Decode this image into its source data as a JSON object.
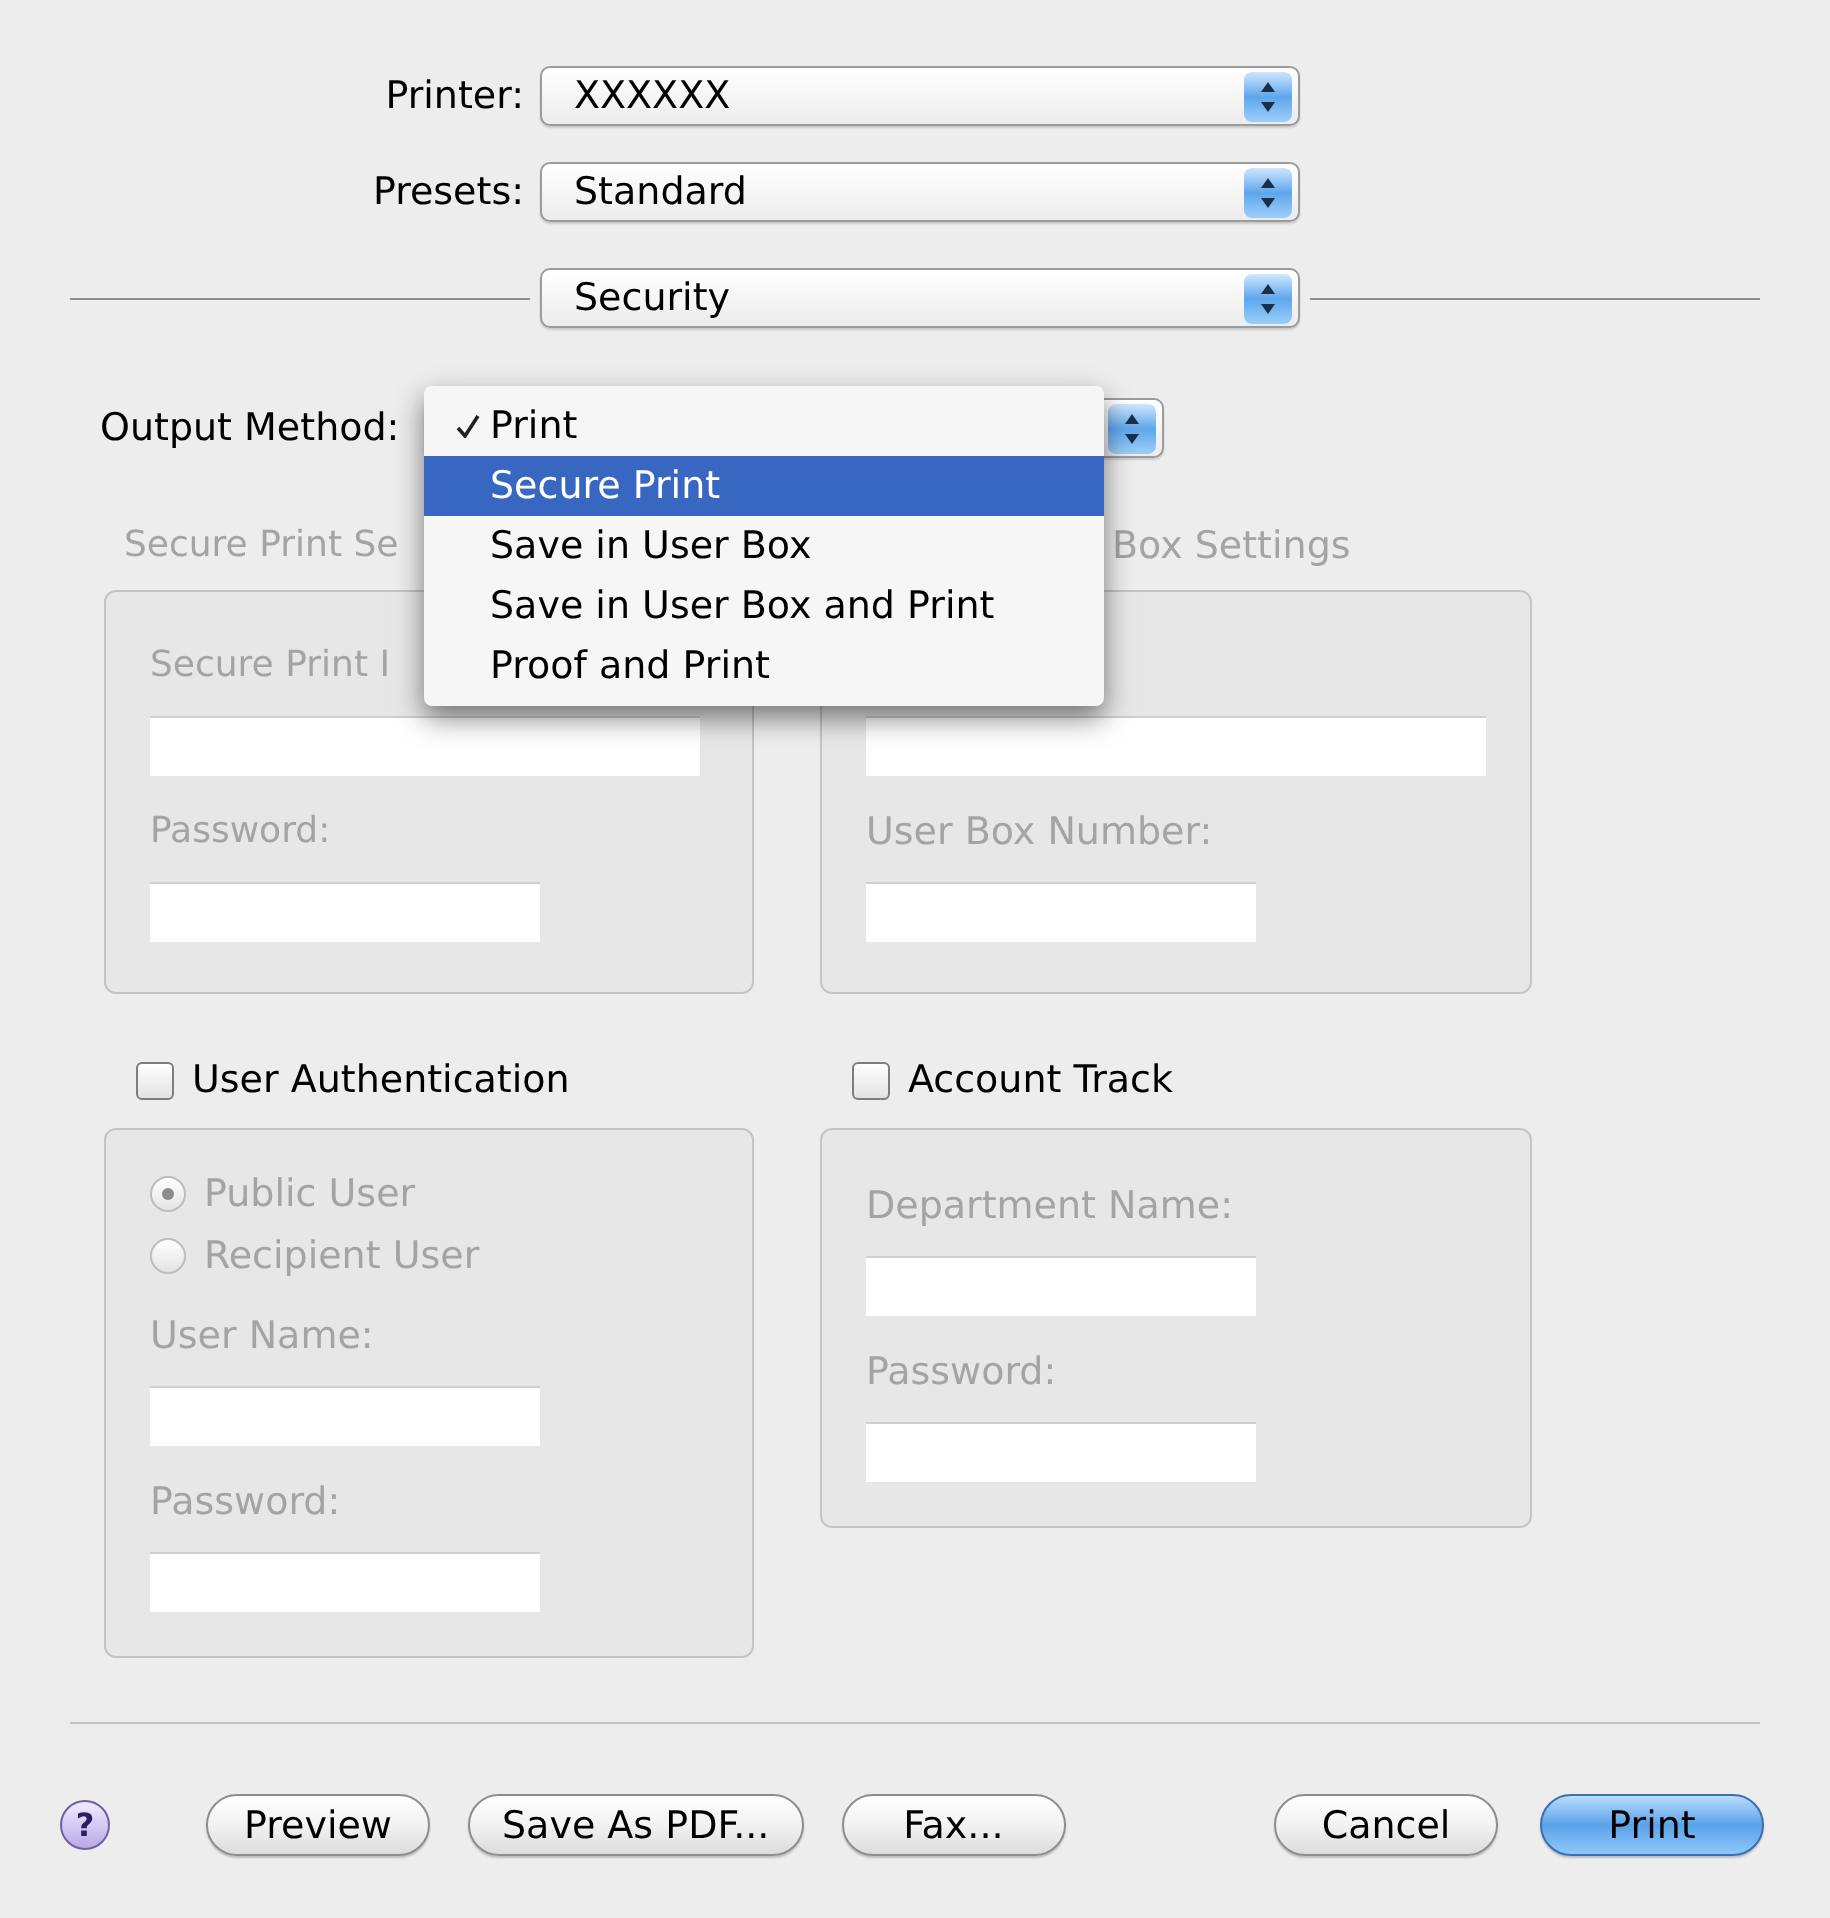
{
  "printer": {
    "label": "Printer:",
    "value": "XXXXXX"
  },
  "presets": {
    "label": "Presets:",
    "value": "Standard"
  },
  "pane_menu": {
    "value": "Security"
  },
  "output_method": {
    "label": "Output Method:",
    "menu": [
      {
        "label": "Print",
        "checked": true,
        "selected": false
      },
      {
        "label": "Secure Print",
        "checked": false,
        "selected": true
      },
      {
        "label": "Save in User Box",
        "checked": false,
        "selected": false
      },
      {
        "label": "Save in User Box and Print",
        "checked": false,
        "selected": false
      },
      {
        "label": "Proof and Print",
        "checked": false,
        "selected": false
      }
    ]
  },
  "settings_panels": [
    {
      "title": "Secure Print Se",
      "disabled": true,
      "items": [
        {
          "kind": "label",
          "text": "Secure Print I"
        },
        {
          "kind": "input"
        },
        {
          "kind": "label",
          "text": "Password:"
        },
        {
          "kind": "input"
        }
      ]
    },
    {
      "title": "Box Settings",
      "disabled": true,
      "items": [
        {
          "kind": "input"
        },
        {
          "kind": "label",
          "text": "User Box Number:"
        },
        {
          "kind": "input"
        }
      ]
    }
  ],
  "option_panels": [
    {
      "checkbox": {
        "label": "User Authentication",
        "checked": false
      },
      "disabled": true,
      "items": [
        {
          "kind": "radio",
          "text": "Public User",
          "selected": true
        },
        {
          "kind": "radio",
          "text": "Recipient User",
          "selected": false
        },
        {
          "kind": "label",
          "text": "User Name:"
        },
        {
          "kind": "input"
        },
        {
          "kind": "label",
          "text": "Password:"
        },
        {
          "kind": "input"
        }
      ]
    },
    {
      "checkbox": {
        "label": "Account Track",
        "checked": false
      },
      "disabled": true,
      "items": [
        {
          "kind": "label",
          "text": "Department Name:"
        },
        {
          "kind": "input"
        },
        {
          "kind": "label",
          "text": "Password:"
        },
        {
          "kind": "input"
        }
      ]
    }
  ],
  "footer": {
    "help": {
      "label": "?"
    },
    "left_buttons": [
      {
        "label": "Preview",
        "default": false
      },
      {
        "label": "Save As PDF...",
        "default": false
      },
      {
        "label": "Fax...",
        "default": false
      }
    ],
    "right_buttons": [
      {
        "label": "Cancel",
        "default": false
      },
      {
        "label": "Print",
        "default": true
      }
    ]
  }
}
